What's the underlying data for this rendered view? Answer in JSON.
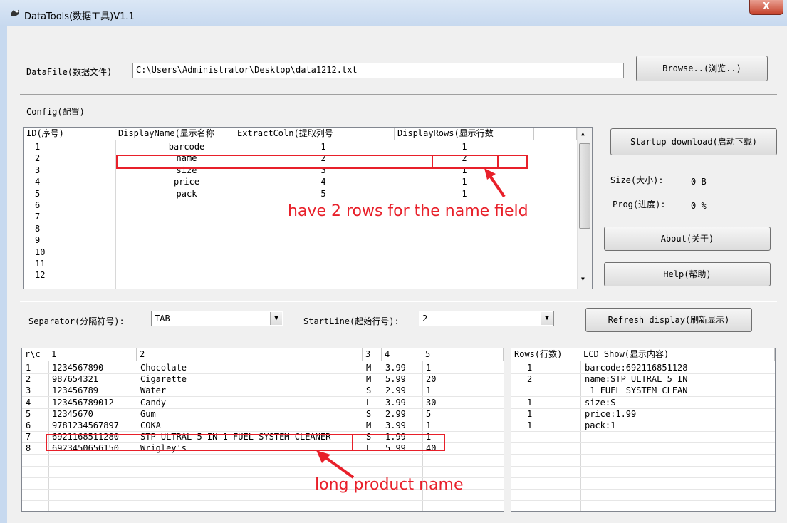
{
  "window": {
    "title": "DataTools(数据工具)V1.1",
    "close_label": "X"
  },
  "datafile": {
    "label": "DataFile(数据文件)",
    "path": "C:\\Users\\Administrator\\Desktop\\data1212.txt",
    "browse_label": "Browse..(浏览..)"
  },
  "config": {
    "label": "Config(配置)",
    "headers": [
      "ID(序号)",
      "DisplayName(显示名称",
      "ExtractColn(提取列号",
      "DisplayRows(显示行数"
    ],
    "rows": [
      {
        "id": "1",
        "name": "barcode",
        "coln": "1",
        "disp": "1"
      },
      {
        "id": "2",
        "name": "name",
        "coln": "2",
        "disp": "2"
      },
      {
        "id": "3",
        "name": "size",
        "coln": "3",
        "disp": "1"
      },
      {
        "id": "4",
        "name": "price",
        "coln": "4",
        "disp": "1"
      },
      {
        "id": "5",
        "name": "pack",
        "coln": "5",
        "disp": "1"
      },
      {
        "id": "6",
        "name": "",
        "coln": "",
        "disp": ""
      },
      {
        "id": "7",
        "name": "",
        "coln": "",
        "disp": ""
      },
      {
        "id": "8",
        "name": "",
        "coln": "",
        "disp": ""
      },
      {
        "id": "9",
        "name": "",
        "coln": "",
        "disp": ""
      },
      {
        "id": "10",
        "name": "",
        "coln": "",
        "disp": ""
      },
      {
        "id": "11",
        "name": "",
        "coln": "",
        "disp": ""
      },
      {
        "id": "12",
        "name": "",
        "coln": "",
        "disp": ""
      }
    ]
  },
  "controls": {
    "startup_label": "Startup download(启动下载)",
    "size_label": "Size(大小):",
    "size_value": "0 B",
    "prog_label": "Prog(进度):",
    "prog_value": "0 %",
    "about_label": "About(关于)",
    "help_label": "Help(帮助)"
  },
  "options": {
    "separator_label": "Separator(分隔符号):",
    "separator_value": "TAB",
    "startline_label": "StartLine(起始行号):",
    "startline_value": "2",
    "refresh_label": "Refresh display(刷新显示)"
  },
  "data_table": {
    "headers": [
      "r\\c",
      "1",
      "2",
      "3",
      "4",
      "5"
    ],
    "rows": [
      [
        "1",
        "1234567890",
        "Chocolate",
        "M",
        "3.99",
        "1"
      ],
      [
        "2",
        "987654321",
        "Cigarette",
        "M",
        "5.99",
        "20"
      ],
      [
        "3",
        "123456789",
        "Water",
        "S",
        "2.99",
        "1"
      ],
      [
        "4",
        "123456789012",
        "Candy",
        "L",
        "3.99",
        "30"
      ],
      [
        "5",
        "12345670",
        "Gum",
        "S",
        "2.99",
        "5"
      ],
      [
        "6",
        "9781234567897",
        "COKA",
        "M",
        "3.99",
        "1"
      ],
      [
        "7",
        "6921168511280",
        "STP ULTRAL 5 IN 1 FUEL SYSTEM CLEANER",
        "S",
        "1.99",
        "1"
      ],
      [
        "8",
        "6923450656150",
        "Wrigley's",
        "L",
        "5.99",
        "40"
      ]
    ]
  },
  "lcd_table": {
    "headers": [
      "Rows(行数)",
      "LCD Show(显示内容)"
    ],
    "rows": [
      [
        "1",
        "barcode:692116851128"
      ],
      [
        "2",
        "name:STP ULTRAL 5 IN"
      ],
      [
        "",
        " 1 FUEL SYSTEM CLEAN"
      ],
      [
        "1",
        "size:S"
      ],
      [
        "1",
        "price:1.99"
      ],
      [
        "1",
        "pack:1"
      ]
    ]
  },
  "annotations": {
    "rows_note": "have 2 rows for the name field",
    "name_note": "long product name"
  },
  "colors": {
    "annotation": "#e8202a",
    "titlebar": "#c7d9ef",
    "close": "#c5412a"
  }
}
